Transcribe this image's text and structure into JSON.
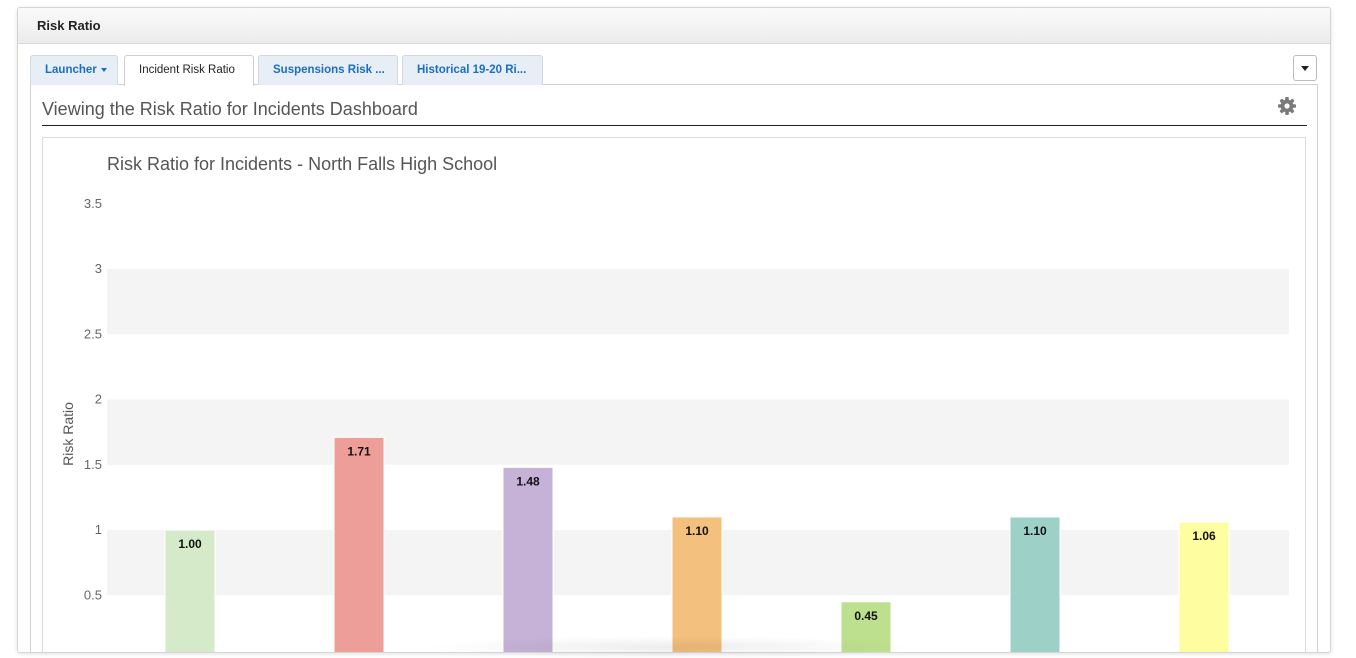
{
  "panel": {
    "title": "Risk Ratio"
  },
  "tabs": [
    {
      "label": "Launcher",
      "has_caret": true
    },
    {
      "label": "Incident Risk Ratio",
      "active": true
    },
    {
      "label": "Suspensions Risk ..."
    },
    {
      "label": "Historical 19-20 Ri..."
    }
  ],
  "dashboard": {
    "title": "Viewing the Risk Ratio for Incidents Dashboard"
  },
  "icons": {
    "gear": "gear-icon",
    "dropdown": "caret-down-icon"
  },
  "chart_data": {
    "type": "bar",
    "title": "Risk Ratio for Incidents - North Falls High School",
    "xlabel": "",
    "ylabel": "Risk Ratio",
    "ylim": [
      0,
      3.5
    ],
    "yticks": [
      "0.5",
      "1",
      "1.5",
      "2",
      "2.5",
      "3",
      "3.5"
    ],
    "grid": "alternating horizontal bands",
    "values": [
      1.0,
      1.71,
      1.48,
      1.1,
      0.45,
      1.1,
      1.06
    ],
    "labels": [
      "1.00",
      "1.71",
      "1.48",
      "1.10",
      "0.45",
      "1.10",
      "1.06"
    ],
    "colors": [
      "#d5eac8",
      "#ed9e99",
      "#c6b2d6",
      "#f4c07d",
      "#bde08e",
      "#9dd1c7",
      "#fefea0"
    ]
  }
}
